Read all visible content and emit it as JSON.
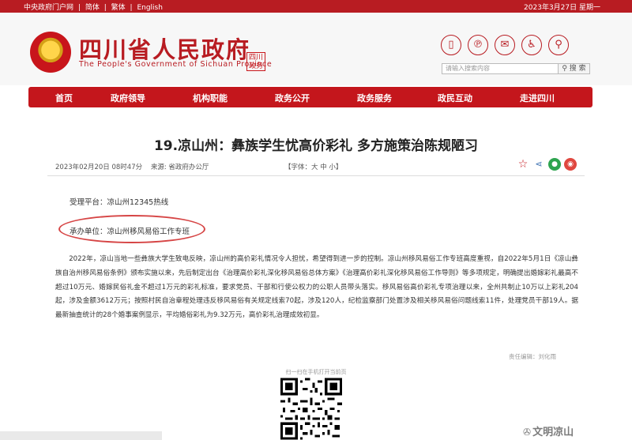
{
  "topbar": {
    "links": [
      "中央政府门户网",
      "|",
      "简体",
      "|",
      "繁体",
      "|",
      "English"
    ],
    "date": "2023年3月27日 星期一"
  },
  "header": {
    "title": "四川省人民政府",
    "subtitle": "The People's Government of Sichuan Province",
    "seal_text": "四川\n政务",
    "search_placeholder": "请输入搜索内容",
    "search_label": "搜 索",
    "icons": [
      "mobile-icon",
      "pinterest-icon",
      "envelope-icon",
      "accessibility-icon",
      "elder-service-icon"
    ]
  },
  "nav": {
    "items": [
      "首页",
      "政府领导",
      "机构职能",
      "政务公开",
      "政务服务",
      "政民互动",
      "走进四川"
    ]
  },
  "article": {
    "title": "19.凉山州：彝族学生忧高价彩礼 多方施策治陈规陋习",
    "datetime": "2023年02月20日 08时47分",
    "source": "来源: 省政府办公厅",
    "font_size": "【字体：大 中 小】",
    "platform": "受理平台：凉山州12345热线",
    "unit": "承办单位：凉山州移风易俗工作专班",
    "body": "2022年，凉山当地一些彝族大学生致电反映，凉山州的高价彩礼情况令人担忧，希望得到进一步的控制。凉山州移风易俗工作专班高度重视，自2022年5月1日《凉山彝族自治州移风易俗条例》颁布实施以来，先后制定出台《治理高价彩礼深化移风易俗总体方案》《治理高价彩礼深化移风易俗工作导则》等多项规定，明确提出婚嫁彩礼最高不超过10万元、婚嫁民俗礼金不超过1万元的彩礼标准，要求党员、干部和行使公权力的公职人员带头落实。移风易俗高价彩礼专项治理以来，全州共制止10万以上彩礼204起，涉及金额3612万元；按照村民自治章程处理违反移风易俗有关规定线索70起，涉及120人，纪检监察部门处置涉及相关移风易俗问题线索11件，处理党员干部19人。据最新抽查统计的28个婚事案例显示，平均婚俗彩礼为9.32万元，高价彩礼治理成效初显。",
    "editor": "责任编辑：刘化雨",
    "qr_caption": "扫一扫在手机打开当前页"
  },
  "share_icons": [
    "star-icon",
    "share-icon",
    "wechat-icon",
    "weibo-icon"
  ],
  "watermark": "文明凉山",
  "colors": {
    "brand": "#b81c22",
    "nav": "#c4161c",
    "highlight": "#d64545"
  }
}
